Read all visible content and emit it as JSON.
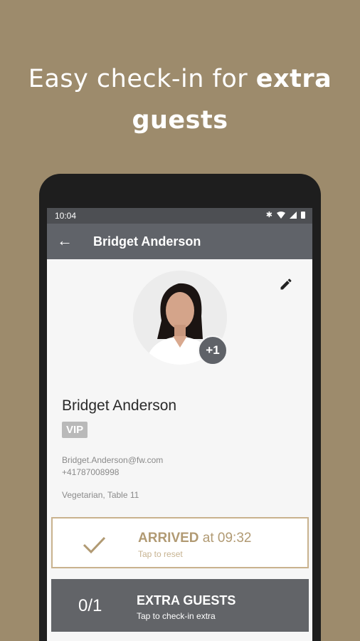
{
  "promo": {
    "headline_regular": "Easy check-in for ",
    "headline_bold_1": "extra",
    "headline_bold_2": "guests"
  },
  "statusbar": {
    "time": "10:04",
    "icons": [
      "bluetooth-icon",
      "wifi-icon",
      "signal-icon",
      "battery-icon"
    ]
  },
  "appbar": {
    "title": "Bridget Anderson"
  },
  "profile": {
    "badge_count": "+1",
    "name": "Bridget Anderson",
    "tag": "VIP",
    "email": "Bridget.Anderson@fw.com",
    "phone": "+41787008998",
    "notes": "Vegetarian, Table 11"
  },
  "arrival": {
    "status_bold": "ARRIVED",
    "status_rest": " at 09:32",
    "hint": "Tap to reset"
  },
  "extras": {
    "count": "0/1",
    "label": "EXTRA GUESTS",
    "hint": "Tap to check-in extra"
  },
  "colors": {
    "background": "#9d8b6c",
    "appbar": "#606369",
    "accent": "#b19a73"
  }
}
